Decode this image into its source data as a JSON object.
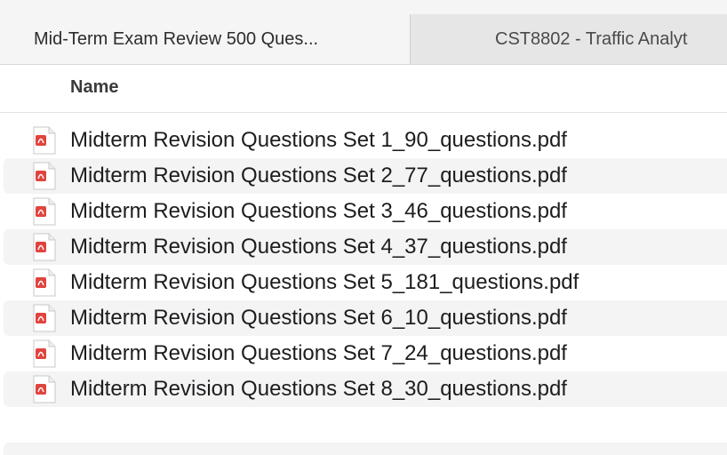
{
  "tabs": [
    {
      "label": "Mid-Term Exam Review 500 Ques...",
      "active": true
    },
    {
      "label": "CST8802 - Traffic Analyt",
      "active": false
    }
  ],
  "columns": {
    "name": "Name"
  },
  "files": [
    {
      "name": "Midterm Revision Questions Set 1_90_questions.pdf",
      "icon": "pdf-icon"
    },
    {
      "name": "Midterm Revision Questions Set 2_77_questions.pdf",
      "icon": "pdf-icon"
    },
    {
      "name": "Midterm Revision Questions Set 3_46_questions.pdf",
      "icon": "pdf-icon"
    },
    {
      "name": "Midterm Revision Questions Set 4_37_questions.pdf",
      "icon": "pdf-icon"
    },
    {
      "name": "Midterm Revision Questions Set 5_181_questions.pdf",
      "icon": "pdf-icon"
    },
    {
      "name": "Midterm Revision Questions Set 6_10_questions.pdf",
      "icon": "pdf-icon"
    },
    {
      "name": "Midterm Revision Questions Set 7_24_questions.pdf",
      "icon": "pdf-icon"
    },
    {
      "name": "Midterm Revision Questions Set 8_30_questions.pdf",
      "icon": "pdf-icon"
    }
  ],
  "colors": {
    "pdf_badge": "#e0443e",
    "row_alt": "#f4f4f5",
    "tab_inactive": "#e6e6e6"
  }
}
